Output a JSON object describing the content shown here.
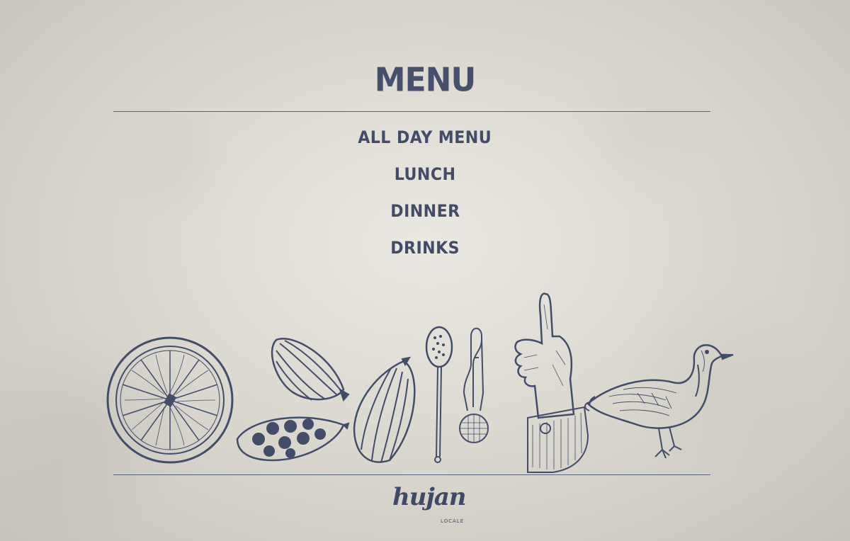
{
  "page": {
    "title": "MENU"
  },
  "menu": {
    "items": [
      {
        "label": "ALL DAY MENU"
      },
      {
        "label": "LUNCH"
      },
      {
        "label": "DINNER"
      },
      {
        "label": "DRINKS"
      }
    ]
  },
  "illustrations": {
    "icons": [
      "orange-slice-icon",
      "cardamom-pod-icon",
      "open-cardamom-pod-icon",
      "cardamom-seed-pod-icon",
      "tea-infuser-spoon-icon",
      "tea-strainer-tongs-icon",
      "pointing-hand-icon",
      "duck-icon"
    ]
  },
  "brand": {
    "logo_text": "hujan",
    "logo_subtext": "LOCALE"
  },
  "colors": {
    "ink": "#424c68",
    "background": "#dcd9d1"
  }
}
